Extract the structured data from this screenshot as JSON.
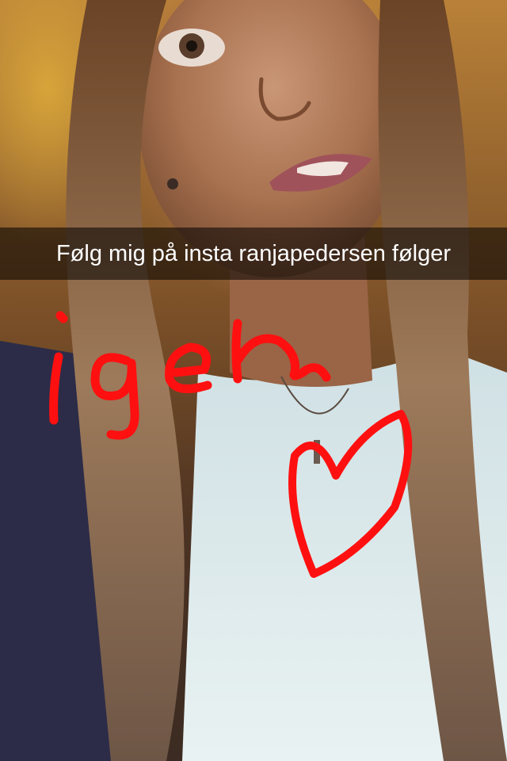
{
  "snap": {
    "caption": "Følg mig på insta ranjapedersen følger",
    "drawing": {
      "word": "igen",
      "shape": "heart",
      "color": "#ff1010"
    }
  }
}
